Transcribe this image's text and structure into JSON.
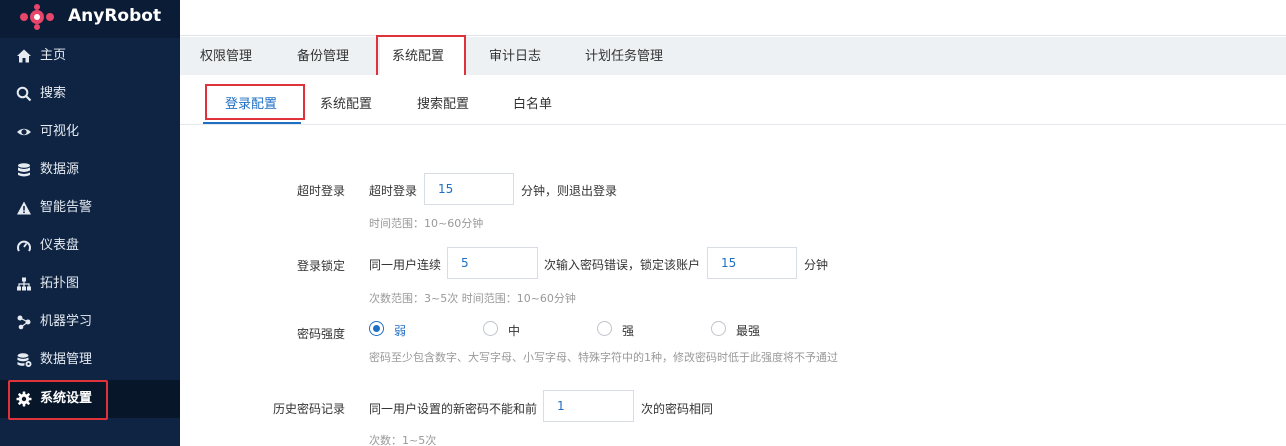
{
  "app": {
    "name": "AnyRobot"
  },
  "sidebar": {
    "items": [
      {
        "label": "主页",
        "icon": "home-icon"
      },
      {
        "label": "搜索",
        "icon": "search-icon"
      },
      {
        "label": "可视化",
        "icon": "eye-icon"
      },
      {
        "label": "数据源",
        "icon": "database-icon"
      },
      {
        "label": "智能告警",
        "icon": "warning-icon"
      },
      {
        "label": "仪表盘",
        "icon": "gauge-icon"
      },
      {
        "label": "拓扑图",
        "icon": "topology-icon"
      },
      {
        "label": "机器学习",
        "icon": "machine-learning-icon"
      },
      {
        "label": "数据管理",
        "icon": "data-management-icon"
      },
      {
        "label": "系统设置",
        "icon": "gear-icon",
        "active": true
      }
    ]
  },
  "tabs": [
    {
      "label": "权限管理"
    },
    {
      "label": "备份管理"
    },
    {
      "label": "系统配置",
      "active": true
    },
    {
      "label": "审计日志"
    },
    {
      "label": "计划任务管理"
    }
  ],
  "subtabs": [
    {
      "label": "登录配置",
      "active": true
    },
    {
      "label": "系统配置"
    },
    {
      "label": "搜索配置"
    },
    {
      "label": "白名单"
    }
  ],
  "form": {
    "timeout": {
      "label": "超时登录",
      "prefix": "超时登录",
      "value": "15",
      "suffix": "分钟，则退出登录",
      "hint": "时间范围：10~60分钟"
    },
    "lock": {
      "label": "登录锁定",
      "prefix": "同一用户连续",
      "attempts": "5",
      "middle": "次输入密码错误，锁定该账户",
      "minutes": "15",
      "suffix": "分钟",
      "hint": "次数范围：3~5次  时间范围：10~60分钟"
    },
    "strength": {
      "label": "密码强度",
      "options": [
        "弱",
        "中",
        "强",
        "最强"
      ],
      "selected": "弱",
      "hint": "密码至少包含数字、大写字母、小写字母、特殊字符中的1种，修改密码时低于此强度将不予通过"
    },
    "history": {
      "label": "历史密码记录",
      "prefix": "同一用户设置的新密码不能和前",
      "value": "1",
      "suffix": "次的密码相同",
      "hint": "次数：1~5次"
    }
  },
  "colors": {
    "sidebar_bg": "#0e2442",
    "accent": "#1f6fc5",
    "highlight": "#e0323a"
  }
}
